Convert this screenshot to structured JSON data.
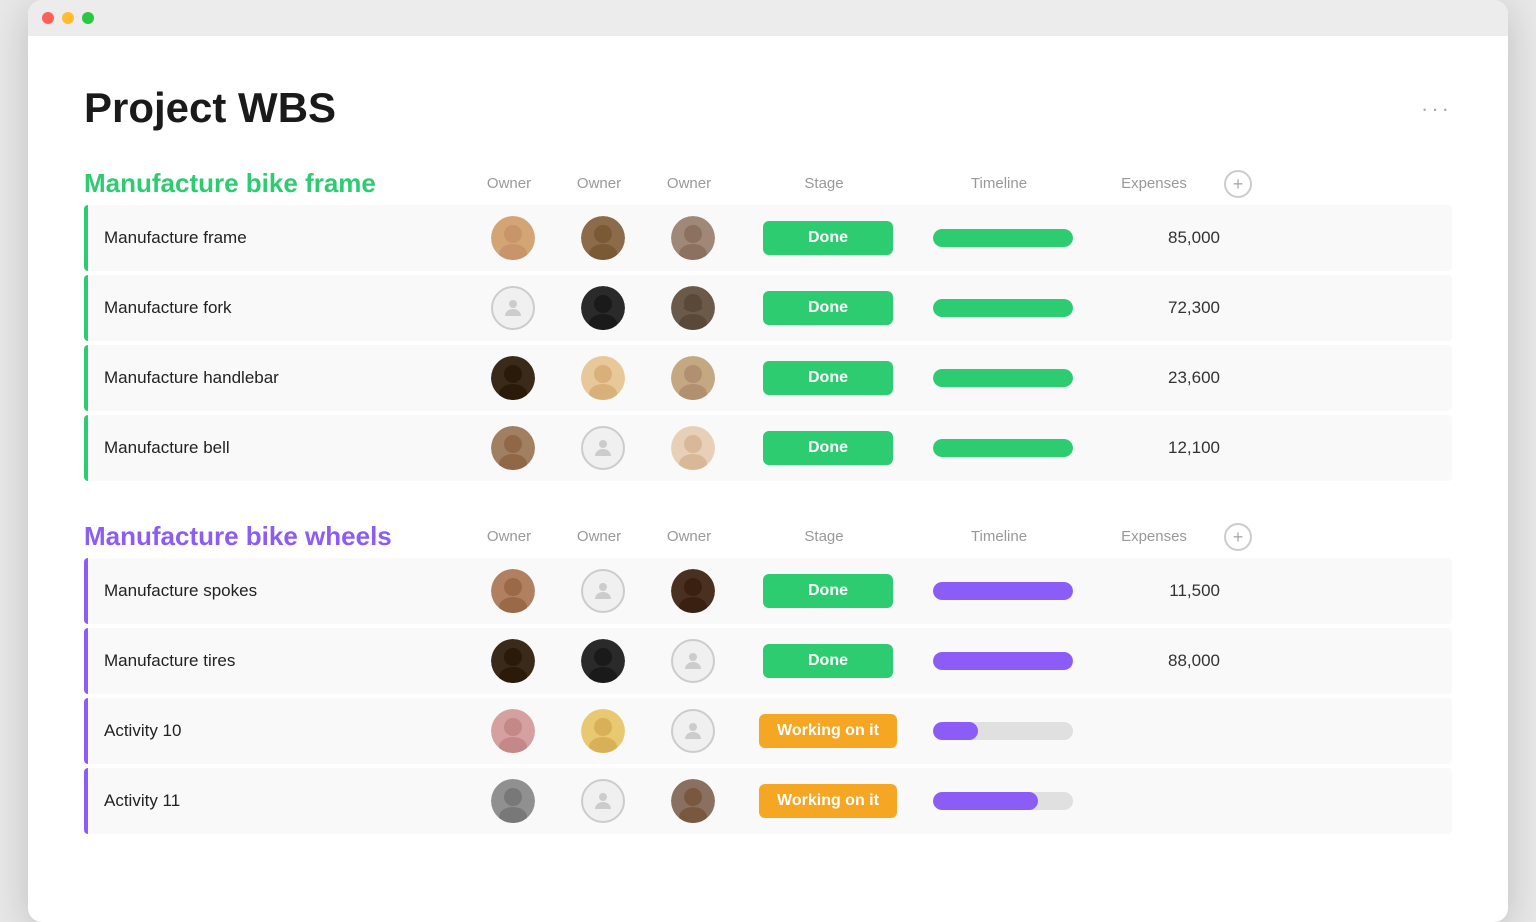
{
  "window": {
    "title": "Project WBS"
  },
  "page": {
    "title": "Project WBS",
    "more_label": "···"
  },
  "sections": [
    {
      "id": "bike-frame",
      "title": "Manufacture bike frame",
      "color": "green",
      "columns": [
        "Owner",
        "Owner",
        "Owner",
        "Stage",
        "Timeline",
        "Expenses"
      ],
      "tasks": [
        {
          "name": "Manufacture frame",
          "owners": [
            "female-brown",
            "female-dark",
            "male-gray"
          ],
          "stage": "Done",
          "stage_type": "done",
          "timeline_pct": 100,
          "timeline_color": "green",
          "expenses": "85,000"
        },
        {
          "name": "Manufacture fork",
          "owners": [
            "placeholder",
            "male-black",
            "male-beard"
          ],
          "stage": "Done",
          "stage_type": "done",
          "timeline_pct": 100,
          "timeline_color": "green",
          "expenses": "72,300"
        },
        {
          "name": "Manufacture handlebar",
          "owners": [
            "male-dark",
            "female-blonde",
            "female-dark2"
          ],
          "stage": "Done",
          "stage_type": "done",
          "timeline_pct": 100,
          "timeline_color": "green",
          "expenses": "23,600"
        },
        {
          "name": "Manufacture bell",
          "owners": [
            "male-gray2",
            "placeholder",
            "female-light"
          ],
          "stage": "Done",
          "stage_type": "done",
          "timeline_pct": 100,
          "timeline_color": "green",
          "expenses": "12,100"
        }
      ]
    },
    {
      "id": "bike-wheels",
      "title": "Manufacture bike wheels",
      "color": "purple",
      "columns": [
        "Owner",
        "Owner",
        "Owner",
        "Stage",
        "Timeline",
        "Expenses"
      ],
      "tasks": [
        {
          "name": "Manufacture spokes",
          "owners": [
            "male-brown",
            "placeholder",
            "female-curly"
          ],
          "stage": "Done",
          "stage_type": "done",
          "timeline_pct": 100,
          "timeline_color": "purple",
          "expenses": "11,500"
        },
        {
          "name": "Manufacture tires",
          "owners": [
            "male-dark2",
            "male-black2",
            "placeholder"
          ],
          "stage": "Done",
          "stage_type": "done",
          "timeline_pct": 100,
          "timeline_color": "purple",
          "expenses": "88,000"
        },
        {
          "name": "Activity 10",
          "owners": [
            "female-pink",
            "female-blonde2",
            "placeholder"
          ],
          "stage": "Working on it",
          "stage_type": "working",
          "timeline_pct": 30,
          "timeline_color": "purple",
          "expenses": ""
        },
        {
          "name": "Activity 11",
          "owners": [
            "male-gray3",
            "placeholder",
            "male-beard2"
          ],
          "stage": "Working on it",
          "stage_type": "working",
          "timeline_pct": 75,
          "timeline_color": "purple",
          "expenses": ""
        }
      ]
    }
  ]
}
